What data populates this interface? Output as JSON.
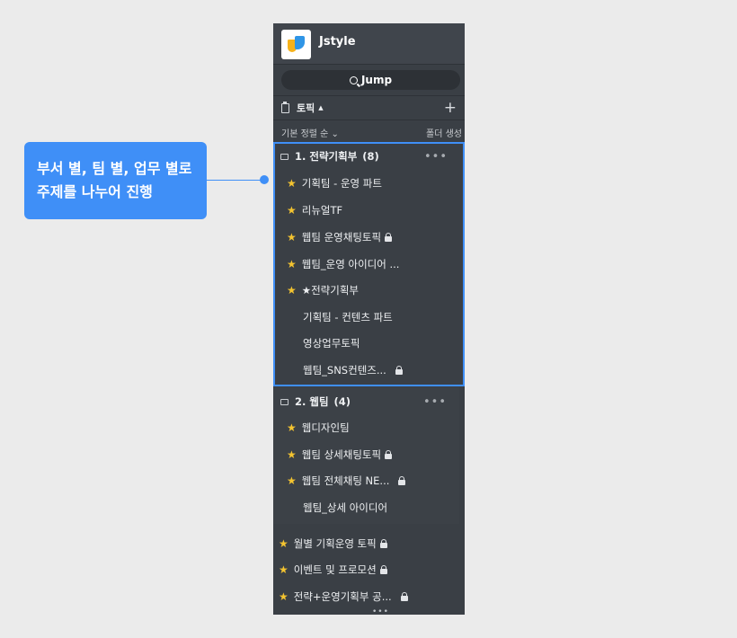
{
  "callout": {
    "line1": "부서 별, 팀 별, 업무 별로",
    "line2": "주제를 나누어 진행"
  },
  "app": {
    "title": "Jstyle"
  },
  "jump": {
    "label": "Jump"
  },
  "topics": {
    "label": "토픽"
  },
  "sort": {
    "label": "기본 정렬 순 ⌄",
    "folder_create": "폴더 생성"
  },
  "group1": {
    "title": "1. 전략기획부",
    "count": "(8)",
    "items": [
      {
        "label": "기획팀 - 운영 파트",
        "starred": true,
        "locked": false
      },
      {
        "label": "리뉴얼TF",
        "starred": true,
        "locked": false
      },
      {
        "label": "웹팀 운영채팅토픽",
        "starred": true,
        "locked": true
      },
      {
        "label": "웹팀_운영 아이디어 ...",
        "starred": true,
        "locked": false
      },
      {
        "label": "★전략기획부",
        "starred": true,
        "locked": false
      },
      {
        "label": "기획팀 - 컨텐츠 파트",
        "starred": false,
        "locked": false
      },
      {
        "label": "영상업무토픽",
        "starred": false,
        "locked": false
      },
      {
        "label": "웹팀_SNS컨텐즈...",
        "starred": false,
        "locked": true
      }
    ]
  },
  "group2": {
    "title": "2. 웹팀",
    "count": "(4)",
    "items": [
      {
        "label": "웹디자인팀",
        "starred": true,
        "locked": false
      },
      {
        "label": "웹팀 상세채팅토픽",
        "starred": true,
        "locked": true
      },
      {
        "label": "웹팀 전체채팅 NE...",
        "starred": true,
        "locked": true
      },
      {
        "label": "웹팀_상세 아이디어",
        "starred": false,
        "locked": false
      }
    ]
  },
  "loose_items": [
    {
      "label": "월별 기획운영 토픽",
      "starred": true,
      "locked": true
    },
    {
      "label": "이벤트 및 프로모션",
      "starred": true,
      "locked": true
    },
    {
      "label": "전략+운영기획부 공...",
      "starred": true,
      "locked": true
    }
  ],
  "colors": {
    "accent": "#3f8ff7",
    "panel": "#3a3f45",
    "star": "#f4c430"
  },
  "icons": {
    "more": "more-dots-icon",
    "star": "star-icon",
    "lock": "lock-icon",
    "folder": "folder-icon"
  }
}
